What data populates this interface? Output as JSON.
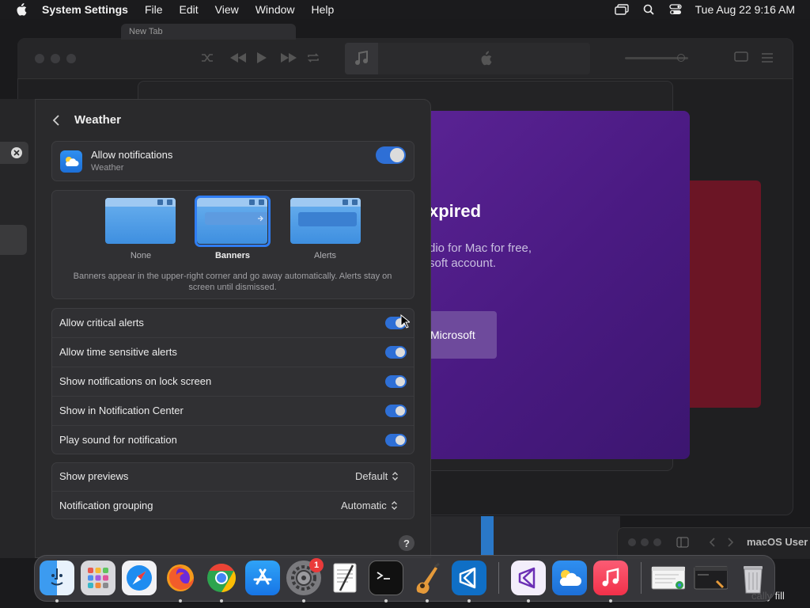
{
  "menubar": {
    "app_name": "System Settings",
    "menus": [
      "File",
      "Edit",
      "View",
      "Window",
      "Help"
    ],
    "clock": "Tue Aug 22  9:16 AM"
  },
  "background": {
    "browser_tab": "New Tab",
    "purple_card": {
      "heading": "xpired",
      "line1": "dio for Mac for free,",
      "line2": "soft account.",
      "button": "Microsoft"
    },
    "finder_title": "macOS User",
    "corner_text": "cally fill"
  },
  "settings": {
    "title": "Weather",
    "allow": {
      "title": "Allow notifications",
      "subtitle": "Weather",
      "enabled": true
    },
    "alert_styles": {
      "options": [
        {
          "label": "None",
          "selected": false
        },
        {
          "label": "Banners",
          "selected": true
        },
        {
          "label": "Alerts",
          "selected": false
        }
      ],
      "description": "Banners appear in the upper-right corner and go away automatically. Alerts stay on screen until dismissed."
    },
    "toggles": [
      {
        "label": "Allow critical alerts",
        "enabled": true
      },
      {
        "label": "Allow time sensitive alerts",
        "enabled": true
      },
      {
        "label": "Show notifications on lock screen",
        "enabled": true
      },
      {
        "label": "Show in Notification Center",
        "enabled": true
      },
      {
        "label": "Play sound for notification",
        "enabled": true
      }
    ],
    "popups": [
      {
        "label": "Show previews",
        "value": "Default"
      },
      {
        "label": "Notification grouping",
        "value": "Automatic"
      }
    ],
    "help": "?"
  },
  "dock": {
    "items": [
      "finder-icon",
      "launchpad-icon",
      "safari-icon",
      "firefox-icon",
      "chrome-icon",
      "app-store-icon",
      "system-settings-icon",
      "textedit-icon",
      "terminal-icon",
      "garageband-icon",
      "vscode-icon",
      "visual-studio-icon",
      "weather-icon",
      "music-icon",
      "preview-window-icon",
      "terminal-window-icon",
      "trash-icon"
    ],
    "settings_badge": "1"
  }
}
